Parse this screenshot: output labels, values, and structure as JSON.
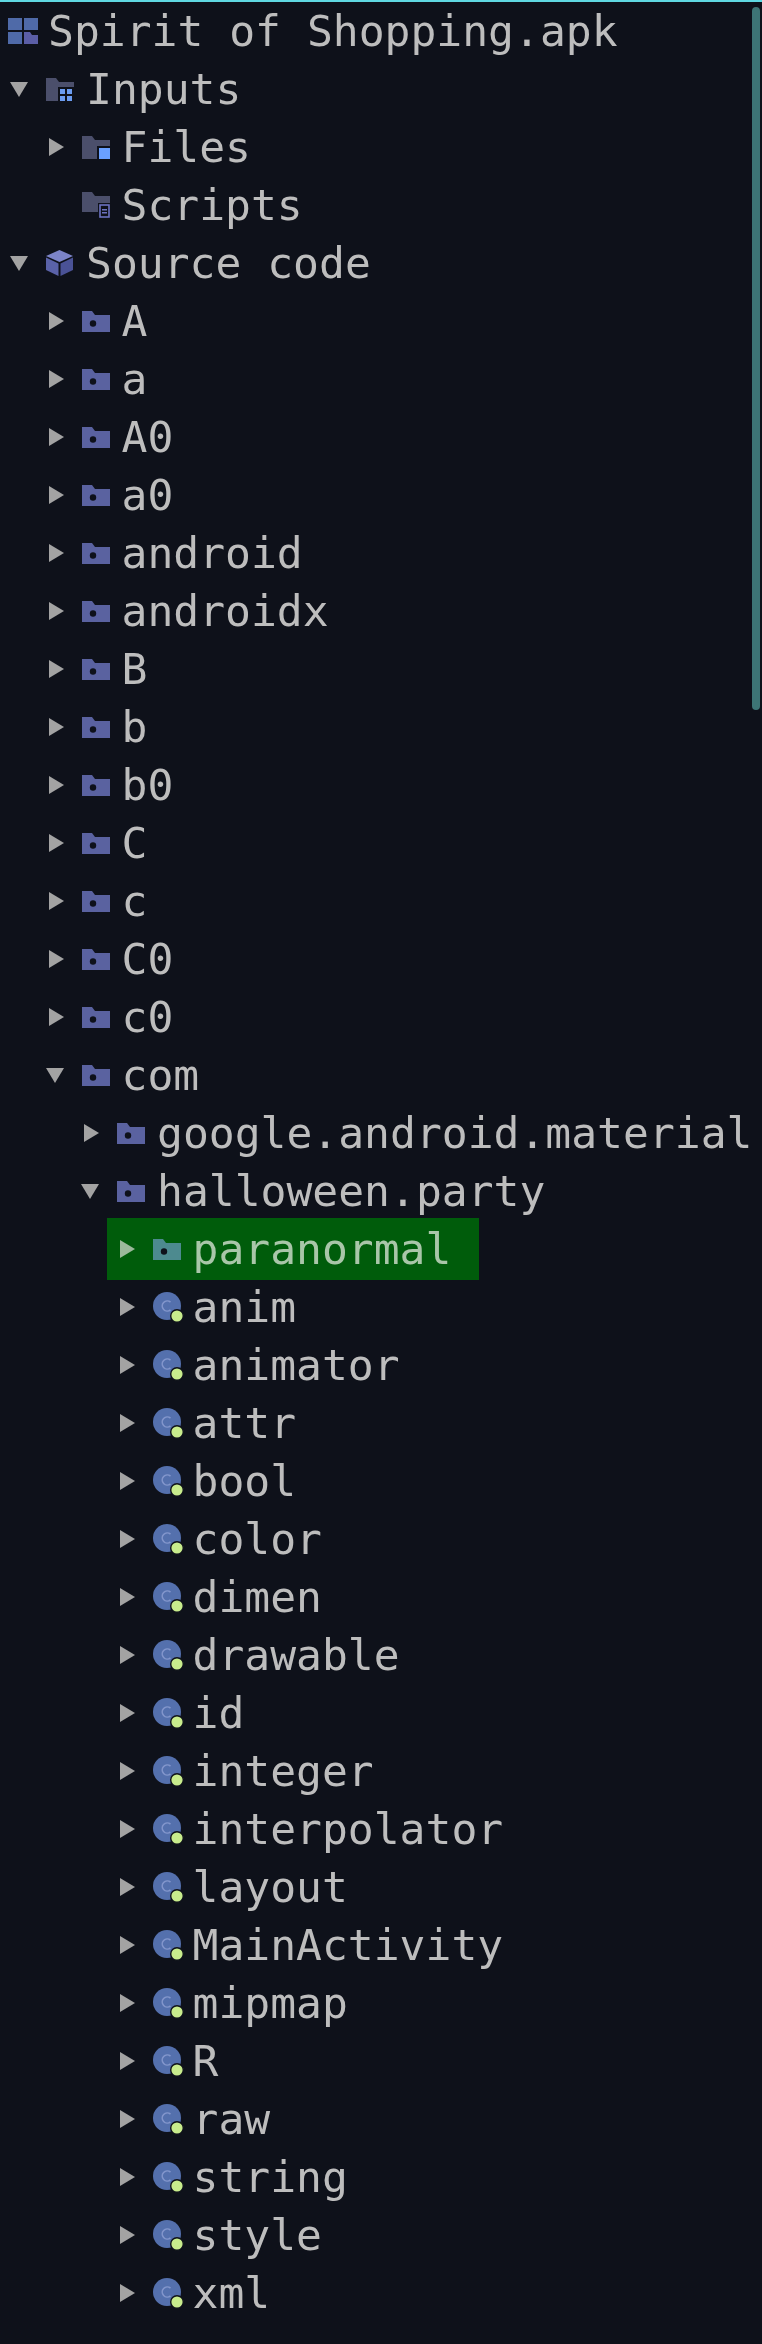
{
  "tree": {
    "label": "Spirit of Shopping.apk",
    "kind": "apk",
    "selected": false,
    "children": [
      {
        "label": "Inputs",
        "kind": "inputs",
        "expanded": true,
        "selected": false,
        "children": [
          {
            "label": "Files",
            "kind": "files",
            "expanded": false,
            "selected": false
          },
          {
            "label": "Scripts",
            "kind": "scripts",
            "selected": false
          }
        ]
      },
      {
        "label": "Source code",
        "kind": "source",
        "expanded": true,
        "selected": false,
        "children": [
          {
            "label": "A",
            "kind": "package",
            "expanded": false,
            "selected": false
          },
          {
            "label": "a",
            "kind": "package",
            "expanded": false,
            "selected": false
          },
          {
            "label": "A0",
            "kind": "package",
            "expanded": false,
            "selected": false
          },
          {
            "label": "a0",
            "kind": "package",
            "expanded": false,
            "selected": false
          },
          {
            "label": "android",
            "kind": "package",
            "expanded": false,
            "selected": false
          },
          {
            "label": "androidx",
            "kind": "package",
            "expanded": false,
            "selected": false
          },
          {
            "label": "B",
            "kind": "package",
            "expanded": false,
            "selected": false
          },
          {
            "label": "b",
            "kind": "package",
            "expanded": false,
            "selected": false
          },
          {
            "label": "b0",
            "kind": "package",
            "expanded": false,
            "selected": false
          },
          {
            "label": "C",
            "kind": "package",
            "expanded": false,
            "selected": false
          },
          {
            "label": "c",
            "kind": "package",
            "expanded": false,
            "selected": false
          },
          {
            "label": "C0",
            "kind": "package",
            "expanded": false,
            "selected": false
          },
          {
            "label": "c0",
            "kind": "package",
            "expanded": false,
            "selected": false
          },
          {
            "label": "com",
            "kind": "package",
            "expanded": true,
            "selected": false,
            "children": [
              {
                "label": "google.android.material",
                "kind": "package",
                "expanded": false,
                "selected": false
              },
              {
                "label": "halloween.party",
                "kind": "package",
                "expanded": true,
                "selected": false,
                "children": [
                  {
                    "label": "paranormal",
                    "kind": "package",
                    "expanded": false,
                    "selected": true
                  },
                  {
                    "label": "anim",
                    "kind": "class",
                    "expanded": false,
                    "selected": false
                  },
                  {
                    "label": "animator",
                    "kind": "class",
                    "expanded": false,
                    "selected": false
                  },
                  {
                    "label": "attr",
                    "kind": "class",
                    "expanded": false,
                    "selected": false
                  },
                  {
                    "label": "bool",
                    "kind": "class",
                    "expanded": false,
                    "selected": false
                  },
                  {
                    "label": "color",
                    "kind": "class",
                    "expanded": false,
                    "selected": false
                  },
                  {
                    "label": "dimen",
                    "kind": "class",
                    "expanded": false,
                    "selected": false
                  },
                  {
                    "label": "drawable",
                    "kind": "class",
                    "expanded": false,
                    "selected": false
                  },
                  {
                    "label": "id",
                    "kind": "class",
                    "expanded": false,
                    "selected": false
                  },
                  {
                    "label": "integer",
                    "kind": "class",
                    "expanded": false,
                    "selected": false
                  },
                  {
                    "label": "interpolator",
                    "kind": "class",
                    "expanded": false,
                    "selected": false
                  },
                  {
                    "label": "layout",
                    "kind": "class",
                    "expanded": false,
                    "selected": false
                  },
                  {
                    "label": "MainActivity",
                    "kind": "class",
                    "expanded": false,
                    "selected": false
                  },
                  {
                    "label": "mipmap",
                    "kind": "class",
                    "expanded": false,
                    "selected": false
                  },
                  {
                    "label": "R",
                    "kind": "class",
                    "expanded": false,
                    "selected": false
                  },
                  {
                    "label": "raw",
                    "kind": "class",
                    "expanded": false,
                    "selected": false
                  },
                  {
                    "label": "string",
                    "kind": "class",
                    "expanded": false,
                    "selected": false
                  },
                  {
                    "label": "style",
                    "kind": "class",
                    "expanded": false,
                    "selected": false
                  },
                  {
                    "label": "xml",
                    "kind": "class",
                    "expanded": false,
                    "selected": false
                  }
                ]
              }
            ]
          }
        ]
      }
    ]
  }
}
